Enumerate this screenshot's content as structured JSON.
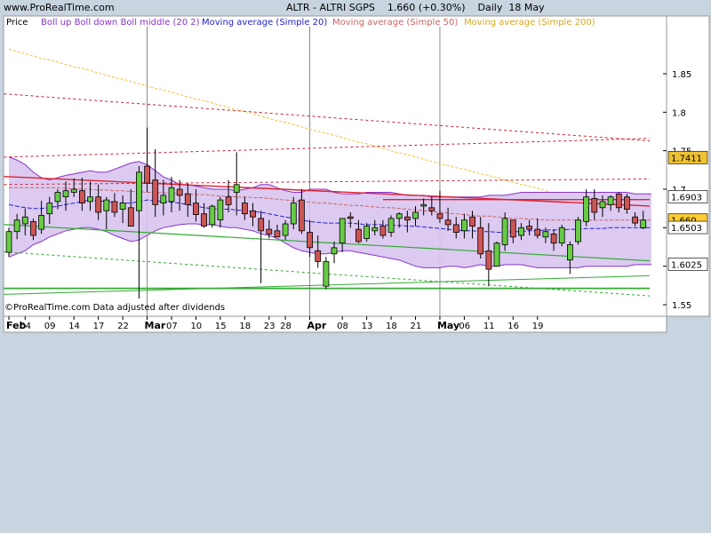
{
  "header": {
    "site": "www.ProRealTime.com",
    "title": "ALTR - ALTRI SGPS    1.660 (+0.30%)    Daily  18 May"
  },
  "legend": {
    "price": "Price",
    "boll": "Boll up Boll down Boll middle (20 2)",
    "ma20": "Moving average (Simple 20)",
    "ma50": "Moving average (Simple 50)",
    "ma200": "Moving average (Simple 200)"
  },
  "footer": {
    "copyright": "©ProRealTime.com  Data adjusted after dividends"
  },
  "colors": {
    "background": "#c8d4e0",
    "plot_bg": "#ffffff",
    "up_candle": "#66cc44",
    "down_candle": "#cc5555",
    "boll_fill": "#d8c4f0",
    "boll_line": "#8833cc",
    "ma20": "#2222cc",
    "ma50": "#cc6666",
    "ma200": "#eec233",
    "trend_red": "#dd2233",
    "trend_green": "#33aa33"
  },
  "chart_data": {
    "type": "candlestick",
    "title": "ALTR - ALTRI SGPS",
    "last_price": "1.660",
    "change": "+0.30%",
    "timeframe": "Daily",
    "date": "18 May",
    "ylim": [
      1.535,
      1.925
    ],
    "y_ticks": [
      "1.85",
      "1.8",
      "1.75",
      "1.7",
      "1.65",
      "1.6",
      "1.55"
    ],
    "price_badges": [
      {
        "value": 1.7411,
        "label": "1.7411",
        "color": "#eec233"
      },
      {
        "value": 1.6903,
        "label": "1.6903",
        "color": "#ffffff"
      },
      {
        "value": 1.66,
        "label": "1.660",
        "color": "#ffcc33"
      },
      {
        "value": 1.6503,
        "label": "1.6503",
        "color": "#ffffff"
      },
      {
        "value": 1.6025,
        "label": "1.6025",
        "color": "#ffffff"
      }
    ],
    "x_labels": [
      {
        "i": 0,
        "label": "Feb",
        "month": true
      },
      {
        "i": 2,
        "label": "04"
      },
      {
        "i": 5,
        "label": "09"
      },
      {
        "i": 8,
        "label": "14"
      },
      {
        "i": 11,
        "label": "17"
      },
      {
        "i": 14,
        "label": "22"
      },
      {
        "i": 17,
        "label": "Mar",
        "month": true
      },
      {
        "i": 20,
        "label": "07"
      },
      {
        "i": 23,
        "label": "10"
      },
      {
        "i": 26,
        "label": "15"
      },
      {
        "i": 29,
        "label": "18"
      },
      {
        "i": 32,
        "label": "23"
      },
      {
        "i": 34,
        "label": "28"
      },
      {
        "i": 37,
        "label": "Apr",
        "month": true
      },
      {
        "i": 41,
        "label": "08"
      },
      {
        "i": 44,
        "label": "13"
      },
      {
        "i": 47,
        "label": "18"
      },
      {
        "i": 50,
        "label": "21"
      },
      {
        "i": 53,
        "label": "May",
        "month": true
      },
      {
        "i": 56,
        "label": "06"
      },
      {
        "i": 59,
        "label": "11"
      },
      {
        "i": 62,
        "label": "16"
      },
      {
        "i": 65,
        "label": "19"
      }
    ],
    "vertical_markers": [
      17,
      37,
      53
    ],
    "candles": [
      {
        "o": 1.618,
        "h": 1.65,
        "l": 1.612,
        "c": 1.645
      },
      {
        "o": 1.645,
        "h": 1.668,
        "l": 1.635,
        "c": 1.66
      },
      {
        "o": 1.655,
        "h": 1.675,
        "l": 1.64,
        "c": 1.664
      },
      {
        "o": 1.658,
        "h": 1.662,
        "l": 1.634,
        "c": 1.64
      },
      {
        "o": 1.648,
        "h": 1.685,
        "l": 1.642,
        "c": 1.666
      },
      {
        "o": 1.668,
        "h": 1.69,
        "l": 1.655,
        "c": 1.682
      },
      {
        "o": 1.684,
        "h": 1.7,
        "l": 1.674,
        "c": 1.696
      },
      {
        "o": 1.69,
        "h": 1.71,
        "l": 1.672,
        "c": 1.698
      },
      {
        "o": 1.696,
        "h": 1.714,
        "l": 1.69,
        "c": 1.7
      },
      {
        "o": 1.698,
        "h": 1.715,
        "l": 1.672,
        "c": 1.682
      },
      {
        "o": 1.684,
        "h": 1.71,
        "l": 1.672,
        "c": 1.69
      },
      {
        "o": 1.69,
        "h": 1.706,
        "l": 1.66,
        "c": 1.67
      },
      {
        "o": 1.672,
        "h": 1.69,
        "l": 1.648,
        "c": 1.686
      },
      {
        "o": 1.684,
        "h": 1.695,
        "l": 1.664,
        "c": 1.67
      },
      {
        "o": 1.674,
        "h": 1.692,
        "l": 1.656,
        "c": 1.682
      },
      {
        "o": 1.676,
        "h": 1.7,
        "l": 1.655,
        "c": 1.652
      },
      {
        "o": 1.672,
        "h": 1.73,
        "l": 1.558,
        "c": 1.722
      },
      {
        "o": 1.73,
        "h": 1.78,
        "l": 1.696,
        "c": 1.708
      },
      {
        "o": 1.712,
        "h": 1.752,
        "l": 1.664,
        "c": 1.68
      },
      {
        "o": 1.682,
        "h": 1.712,
        "l": 1.666,
        "c": 1.692
      },
      {
        "o": 1.684,
        "h": 1.716,
        "l": 1.67,
        "c": 1.702
      },
      {
        "o": 1.7,
        "h": 1.712,
        "l": 1.672,
        "c": 1.692
      },
      {
        "o": 1.694,
        "h": 1.708,
        "l": 1.664,
        "c": 1.68
      },
      {
        "o": 1.682,
        "h": 1.7,
        "l": 1.658,
        "c": 1.667
      },
      {
        "o": 1.668,
        "h": 1.682,
        "l": 1.65,
        "c": 1.652
      },
      {
        "o": 1.654,
        "h": 1.68,
        "l": 1.65,
        "c": 1.678
      },
      {
        "o": 1.66,
        "h": 1.69,
        "l": 1.65,
        "c": 1.686
      },
      {
        "o": 1.69,
        "h": 1.712,
        "l": 1.67,
        "c": 1.68
      },
      {
        "o": 1.696,
        "h": 1.748,
        "l": 1.666,
        "c": 1.706
      },
      {
        "o": 1.682,
        "h": 1.69,
        "l": 1.66,
        "c": 1.668
      },
      {
        "o": 1.672,
        "h": 1.682,
        "l": 1.652,
        "c": 1.664
      },
      {
        "o": 1.662,
        "h": 1.672,
        "l": 1.578,
        "c": 1.646
      },
      {
        "o": 1.648,
        "h": 1.66,
        "l": 1.636,
        "c": 1.642
      },
      {
        "o": 1.646,
        "h": 1.654,
        "l": 1.638,
        "c": 1.638
      },
      {
        "o": 1.64,
        "h": 1.66,
        "l": 1.634,
        "c": 1.655
      },
      {
        "o": 1.655,
        "h": 1.69,
        "l": 1.648,
        "c": 1.682
      },
      {
        "o": 1.686,
        "h": 1.7,
        "l": 1.642,
        "c": 1.646
      },
      {
        "o": 1.644,
        "h": 1.66,
        "l": 1.612,
        "c": 1.624
      },
      {
        "o": 1.62,
        "h": 1.64,
        "l": 1.598,
        "c": 1.606
      },
      {
        "o": 1.574,
        "h": 1.612,
        "l": 1.57,
        "c": 1.606
      },
      {
        "o": 1.616,
        "h": 1.632,
        "l": 1.604,
        "c": 1.624
      },
      {
        "o": 1.63,
        "h": 1.65,
        "l": 1.618,
        "c": 1.662
      },
      {
        "o": 1.664,
        "h": 1.67,
        "l": 1.65,
        "c": 1.662
      },
      {
        "o": 1.648,
        "h": 1.66,
        "l": 1.63,
        "c": 1.632
      },
      {
        "o": 1.636,
        "h": 1.656,
        "l": 1.632,
        "c": 1.652
      },
      {
        "o": 1.646,
        "h": 1.66,
        "l": 1.64,
        "c": 1.65
      },
      {
        "o": 1.652,
        "h": 1.66,
        "l": 1.636,
        "c": 1.64
      },
      {
        "o": 1.644,
        "h": 1.666,
        "l": 1.638,
        "c": 1.662
      },
      {
        "o": 1.662,
        "h": 1.67,
        "l": 1.65,
        "c": 1.668
      },
      {
        "o": 1.664,
        "h": 1.672,
        "l": 1.644,
        "c": 1.66
      },
      {
        "o": 1.662,
        "h": 1.678,
        "l": 1.652,
        "c": 1.67
      },
      {
        "o": 1.678,
        "h": 1.688,
        "l": 1.666,
        "c": 1.68
      },
      {
        "o": 1.676,
        "h": 1.69,
        "l": 1.666,
        "c": 1.672
      },
      {
        "o": 1.668,
        "h": 1.698,
        "l": 1.656,
        "c": 1.662
      },
      {
        "o": 1.66,
        "h": 1.676,
        "l": 1.646,
        "c": 1.654
      },
      {
        "o": 1.654,
        "h": 1.664,
        "l": 1.636,
        "c": 1.644
      },
      {
        "o": 1.646,
        "h": 1.668,
        "l": 1.636,
        "c": 1.66
      },
      {
        "o": 1.664,
        "h": 1.672,
        "l": 1.636,
        "c": 1.652
      },
      {
        "o": 1.65,
        "h": 1.664,
        "l": 1.61,
        "c": 1.616
      },
      {
        "o": 1.62,
        "h": 1.656,
        "l": 1.574,
        "c": 1.596
      },
      {
        "o": 1.6,
        "h": 1.632,
        "l": 1.6,
        "c": 1.63
      },
      {
        "o": 1.628,
        "h": 1.67,
        "l": 1.62,
        "c": 1.662
      },
      {
        "o": 1.66,
        "h": 1.66,
        "l": 1.63,
        "c": 1.638
      },
      {
        "o": 1.64,
        "h": 1.656,
        "l": 1.634,
        "c": 1.65
      },
      {
        "o": 1.652,
        "h": 1.66,
        "l": 1.64,
        "c": 1.648
      },
      {
        "o": 1.648,
        "h": 1.662,
        "l": 1.636,
        "c": 1.64
      },
      {
        "o": 1.638,
        "h": 1.65,
        "l": 1.63,
        "c": 1.645
      },
      {
        "o": 1.642,
        "h": 1.648,
        "l": 1.62,
        "c": 1.63
      },
      {
        "o": 1.63,
        "h": 1.654,
        "l": 1.626,
        "c": 1.65
      },
      {
        "o": 1.608,
        "h": 1.632,
        "l": 1.59,
        "c": 1.628
      },
      {
        "o": 1.632,
        "h": 1.664,
        "l": 1.628,
        "c": 1.66
      },
      {
        "o": 1.658,
        "h": 1.7,
        "l": 1.652,
        "c": 1.69
      },
      {
        "o": 1.688,
        "h": 1.7,
        "l": 1.66,
        "c": 1.67
      },
      {
        "o": 1.676,
        "h": 1.692,
        "l": 1.664,
        "c": 1.684
      },
      {
        "o": 1.68,
        "h": 1.692,
        "l": 1.672,
        "c": 1.69
      },
      {
        "o": 1.694,
        "h": 1.696,
        "l": 1.67,
        "c": 1.676
      },
      {
        "o": 1.69,
        "h": 1.694,
        "l": 1.668,
        "c": 1.674
      },
      {
        "o": 1.664,
        "h": 1.67,
        "l": 1.652,
        "c": 1.656
      },
      {
        "o": 1.65,
        "h": 1.672,
        "l": 1.648,
        "c": 1.66
      }
    ],
    "bollinger_upper": [
      1.742,
      1.738,
      1.732,
      1.722,
      1.715,
      1.712,
      1.715,
      1.718,
      1.72,
      1.722,
      1.724,
      1.722,
      1.722,
      1.726,
      1.73,
      1.734,
      1.736,
      1.732,
      1.724,
      1.716,
      1.712,
      1.706,
      1.706,
      1.704,
      1.702,
      1.7,
      1.7,
      1.7,
      1.698,
      1.7,
      1.702,
      1.706,
      1.706,
      1.702,
      1.698,
      1.696,
      1.696,
      1.7,
      1.7,
      1.7,
      1.696,
      1.694,
      1.694,
      1.694,
      1.696,
      1.696,
      1.696,
      1.696,
      1.694,
      1.692,
      1.692,
      1.692,
      1.69,
      1.69,
      1.69,
      1.69,
      1.69,
      1.69,
      1.69,
      1.692,
      1.692,
      1.692,
      1.694,
      1.696,
      1.696,
      1.696,
      1.696,
      1.696,
      1.696,
      1.696,
      1.696,
      1.696,
      1.696,
      1.696,
      1.696,
      1.696,
      1.696,
      1.694,
      1.694,
      1.694
    ],
    "bollinger_lower": [
      1.612,
      1.616,
      1.62,
      1.628,
      1.632,
      1.638,
      1.642,
      1.646,
      1.648,
      1.65,
      1.65,
      1.648,
      1.645,
      1.64,
      1.636,
      1.632,
      1.634,
      1.64,
      1.646,
      1.65,
      1.652,
      1.654,
      1.655,
      1.655,
      1.654,
      1.654,
      1.652,
      1.65,
      1.65,
      1.648,
      1.646,
      1.642,
      1.64,
      1.636,
      1.63,
      1.624,
      1.62,
      1.618,
      1.616,
      1.616,
      1.618,
      1.62,
      1.62,
      1.618,
      1.616,
      1.614,
      1.612,
      1.61,
      1.608,
      1.604,
      1.6,
      1.598,
      1.598,
      1.598,
      1.6,
      1.6,
      1.598,
      1.6,
      1.602,
      1.6,
      1.6,
      1.602,
      1.602,
      1.602,
      1.6,
      1.598,
      1.598,
      1.598,
      1.598,
      1.598,
      1.598,
      1.6,
      1.6,
      1.6,
      1.6,
      1.6,
      1.6,
      1.602,
      1.602,
      1.602
    ],
    "ma20": [
      1.68,
      1.678,
      1.676,
      1.675,
      1.675,
      1.676,
      1.678,
      1.68,
      1.682,
      1.684,
      1.686,
      1.685,
      1.684,
      1.683,
      1.682,
      1.682,
      1.684,
      1.686,
      1.685,
      1.684,
      1.683,
      1.682,
      1.68,
      1.678,
      1.676,
      1.675,
      1.674,
      1.674,
      1.673,
      1.672,
      1.671,
      1.67,
      1.668,
      1.666,
      1.664,
      1.662,
      1.66,
      1.658,
      1.657,
      1.656,
      1.656,
      1.656,
      1.656,
      1.655,
      1.654,
      1.654,
      1.654,
      1.653,
      1.653,
      1.652,
      1.652,
      1.651,
      1.65,
      1.649,
      1.648,
      1.647,
      1.646,
      1.646,
      1.645,
      1.645,
      1.644,
      1.644,
      1.645,
      1.645,
      1.646,
      1.646,
      1.647,
      1.647,
      1.647,
      1.648,
      1.648,
      1.649,
      1.649,
      1.649,
      1.65,
      1.65,
      1.65,
      1.65,
      1.65,
      1.65
    ],
    "ma50": [
      1.702,
      1.702,
      1.702,
      1.702,
      1.702,
      1.702,
      1.702,
      1.701,
      1.701,
      1.7,
      1.7,
      1.699,
      1.699,
      1.698,
      1.698,
      1.697,
      1.697,
      1.696,
      1.696,
      1.695,
      1.695,
      1.694,
      1.694,
      1.693,
      1.693,
      1.692,
      1.691,
      1.691,
      1.69,
      1.69,
      1.689,
      1.689,
      1.688,
      1.687,
      1.686,
      1.685,
      1.684,
      1.683,
      1.682,
      1.682,
      1.681,
      1.68,
      1.679,
      1.679,
      1.678,
      1.677,
      1.676,
      1.676,
      1.675,
      1.674,
      1.673,
      1.672,
      1.671,
      1.67,
      1.669,
      1.668,
      1.667,
      1.666,
      1.665,
      1.665,
      1.664,
      1.663,
      1.662,
      1.662,
      1.661,
      1.661,
      1.66,
      1.66,
      1.66,
      1.66,
      1.66,
      1.66,
      1.66,
      1.66,
      1.66,
      1.66,
      1.66,
      1.66,
      1.66,
      1.66
    ],
    "ma200": [
      1.882,
      1.879,
      1.876,
      1.873,
      1.87,
      1.868,
      1.865,
      1.862,
      1.859,
      1.857,
      1.854,
      1.851,
      1.848,
      1.845,
      1.843,
      1.84,
      1.837,
      1.834,
      1.831,
      1.829,
      1.826,
      1.823,
      1.82,
      1.817,
      1.815,
      1.812,
      1.809,
      1.806,
      1.803,
      1.801,
      1.798,
      1.795,
      1.792,
      1.789,
      1.787,
      1.784,
      1.781,
      1.778,
      1.775,
      1.773,
      1.77,
      1.767,
      1.764,
      1.761,
      1.759,
      1.756,
      1.753,
      1.75,
      1.747,
      1.745,
      1.742,
      1.739,
      1.736,
      1.733,
      1.731,
      1.728,
      1.726,
      1.723,
      1.72,
      1.718,
      1.715,
      1.712,
      1.709,
      1.706,
      1.704,
      1.701,
      1.698,
      1.695,
      1.692,
      1.69,
      1.687,
      1.684,
      1.681,
      1.678,
      1.676,
      1.673,
      1.67,
      1.667,
      1.664,
      1.662
    ],
    "trendlines": [
      {
        "from_i": -0.6,
        "from_v": 1.7165,
        "to_i": 78.8,
        "to_v": 1.6781,
        "color": "#dd2233",
        "style": "solid",
        "width": 1.4
      },
      {
        "from_i": 46.0,
        "from_v": 1.6865,
        "to_i": 78.8,
        "to_v": 1.6865,
        "color": "#dd2233",
        "style": "solid",
        "width": 1.4
      },
      {
        "from_i": -0.6,
        "from_v": 1.8239,
        "to_i": 78.8,
        "to_v": 1.7628,
        "color": "#cc2233",
        "style": "dashed",
        "width": 1
      },
      {
        "from_i": -0.6,
        "from_v": 1.7417,
        "to_i": 78.8,
        "to_v": 1.766,
        "color": "#cc2233",
        "style": "dashed",
        "width": 1
      },
      {
        "from_i": -0.6,
        "from_v": 1.7061,
        "to_i": 78.8,
        "to_v": 1.7133,
        "color": "#cc2233",
        "style": "dashed",
        "width": 1
      },
      {
        "from_i": -0.6,
        "from_v": 1.6541,
        "to_i": 78.8,
        "to_v": 1.607,
        "color": "#33aa33",
        "style": "solid",
        "width": 1.2
      },
      {
        "from_i": -0.6,
        "from_v": 1.6186,
        "to_i": 78.8,
        "to_v": 1.5614,
        "color": "#33aa33",
        "style": "dashed",
        "width": 1
      },
      {
        "from_i": -0.6,
        "from_v": 1.5634,
        "to_i": 78.8,
        "to_v": 1.5877,
        "color": "#33aa33",
        "style": "solid",
        "width": 1
      },
      {
        "from_i": -0.6,
        "from_v": 1.5712,
        "to_i": 78.8,
        "to_v": 1.5712,
        "color": "#33aa33",
        "style": "solid",
        "width": 1.8
      }
    ]
  }
}
